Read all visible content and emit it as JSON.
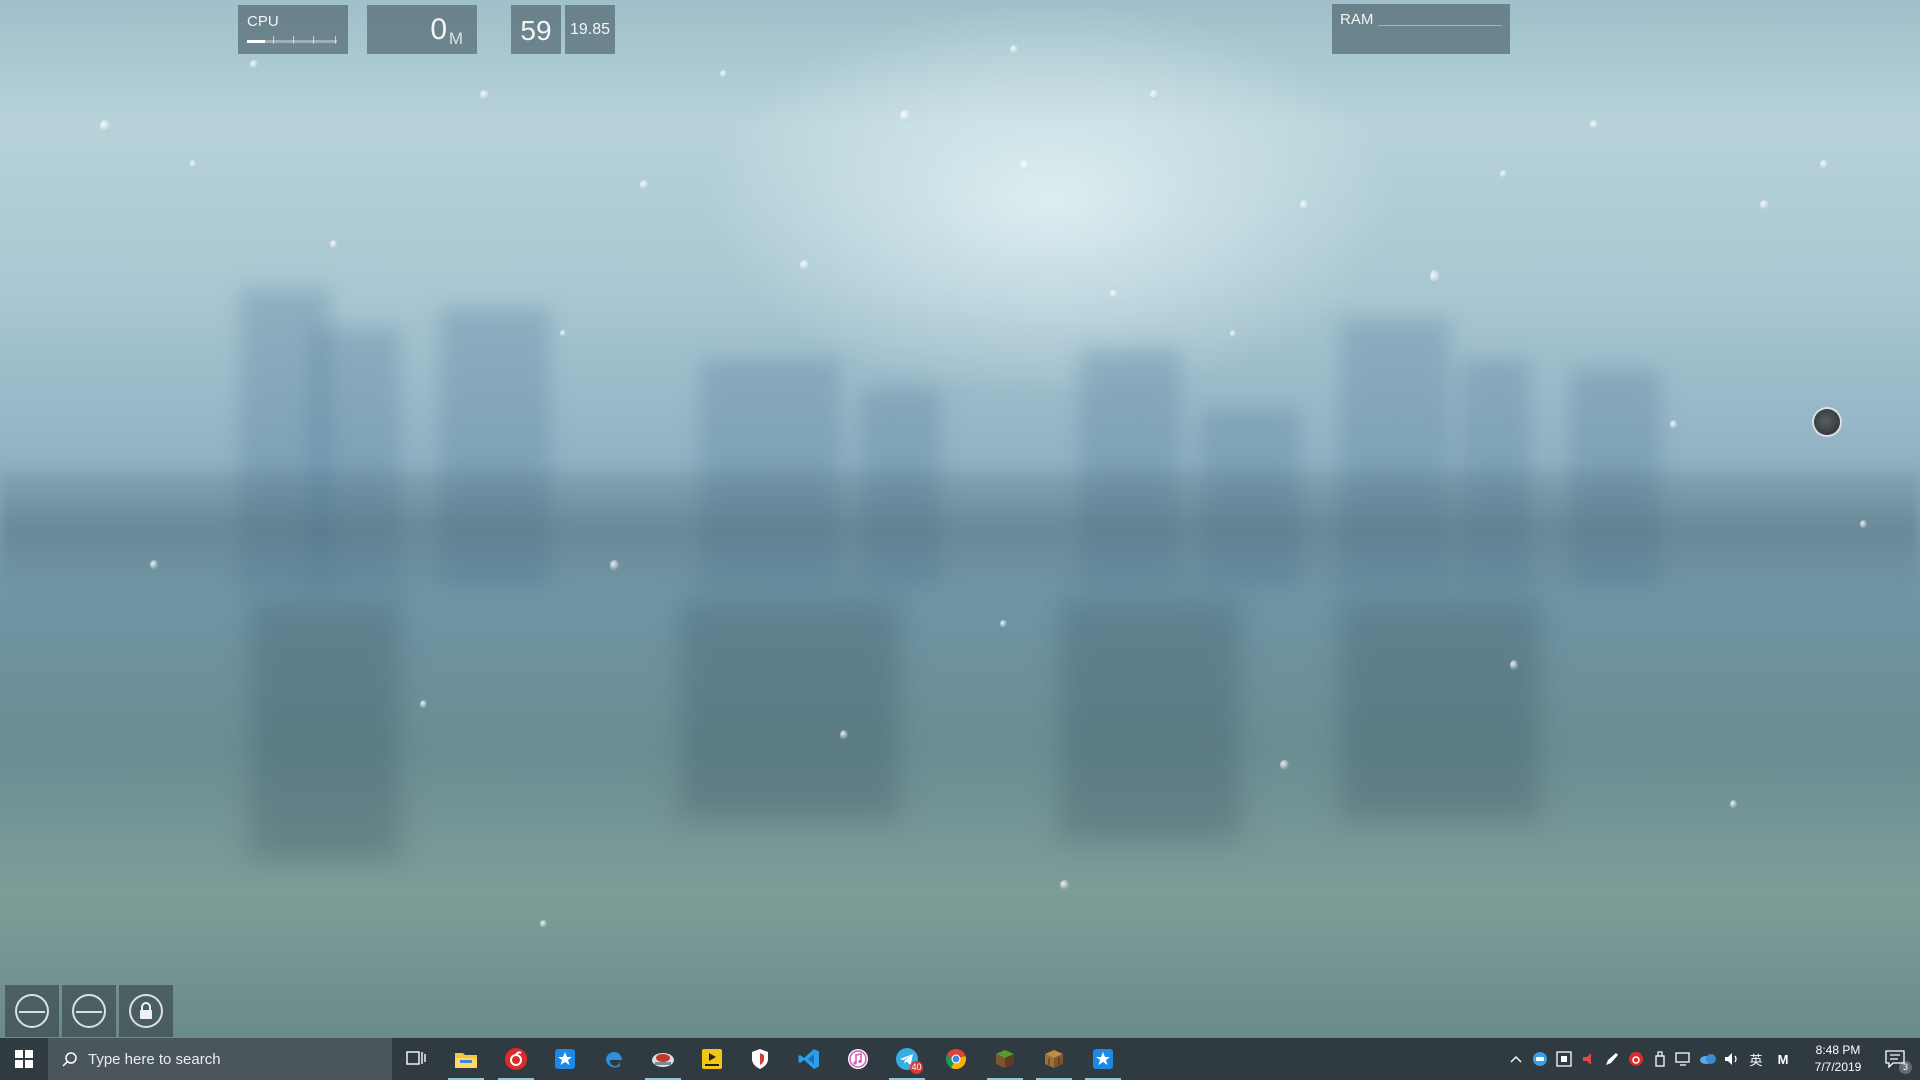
{
  "widgets": {
    "cpu": {
      "label": "CPU",
      "usage_fraction": 0.2
    },
    "network": {
      "value": "0",
      "unit": "M"
    },
    "fps": {
      "value": "59"
    },
    "temperature": {
      "value": "19.85"
    },
    "ram": {
      "label": "RAM"
    }
  },
  "launcher": {
    "buttons": [
      {
        "icon": "minus-circle-icon"
      },
      {
        "icon": "minus-circle-icon"
      },
      {
        "icon": "lock-icon"
      }
    ]
  },
  "taskbar": {
    "search": {
      "placeholder": "Type here to search"
    },
    "apps": [
      {
        "name": "task-view",
        "icon": "task-view-icon",
        "active": false
      },
      {
        "name": "file-explorer",
        "icon": "folder-icon",
        "active": true
      },
      {
        "name": "netease-music",
        "icon": "music-circle-icon",
        "active": true,
        "color": "#e02a2a"
      },
      {
        "name": "app-store",
        "icon": "star-app-icon",
        "active": false,
        "color": "#1e88e5"
      },
      {
        "name": "edge",
        "icon": "edge-icon",
        "active": false,
        "color": "#2f8fe0"
      },
      {
        "name": "game-client",
        "icon": "game-icon",
        "active": true
      },
      {
        "name": "playit",
        "icon": "playit-icon",
        "active": false,
        "color": "#f2c618"
      },
      {
        "name": "security",
        "icon": "shield-icon",
        "active": false
      },
      {
        "name": "vscode",
        "icon": "vscode-icon",
        "active": false,
        "color": "#2a9ee8"
      },
      {
        "name": "itunes",
        "icon": "itunes-icon",
        "active": false
      },
      {
        "name": "telegram",
        "icon": "telegram-icon",
        "active": true,
        "badge": "40",
        "color": "#37aee2"
      },
      {
        "name": "chrome",
        "icon": "chrome-icon",
        "active": false
      },
      {
        "name": "minecraft",
        "icon": "grass-block-icon",
        "active": true,
        "color": "#5b9b2e"
      },
      {
        "name": "crate-app",
        "icon": "crate-icon",
        "active": true,
        "color": "#a0703a"
      },
      {
        "name": "star-app",
        "icon": "star-app-icon",
        "active": true,
        "color": "#1e88e5"
      }
    ],
    "tray": [
      {
        "icon": "chevron-up-icon"
      },
      {
        "icon": "chat-icon"
      },
      {
        "icon": "grid-icon"
      },
      {
        "icon": "speaker-red-icon"
      },
      {
        "icon": "pen-icon"
      },
      {
        "icon": "music-tray-icon"
      },
      {
        "icon": "usb-icon"
      },
      {
        "icon": "network-icon"
      },
      {
        "icon": "onedrive-icon"
      },
      {
        "icon": "volume-icon"
      },
      {
        "icon": "ime-icon",
        "text": "英"
      },
      {
        "icon": "m-icon",
        "text": "M"
      }
    ],
    "clock": {
      "time": "8:48 PM",
      "date": "7/7/2019"
    },
    "notifications": {
      "count": "3"
    }
  }
}
